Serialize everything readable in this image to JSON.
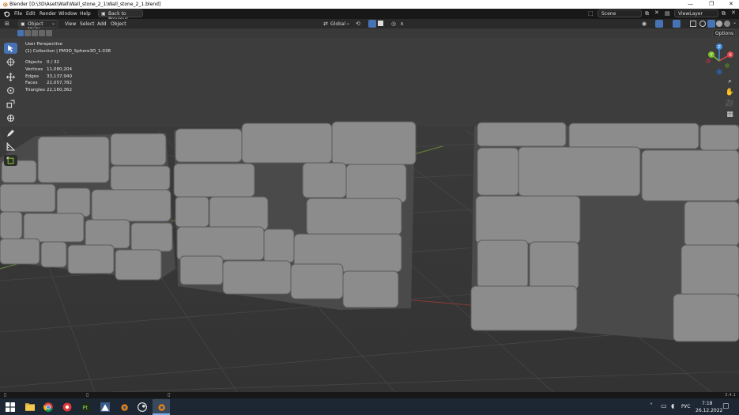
{
  "window": {
    "title": "Blender [D:\\3D\\Aset\\Wall\\Wall_stone_2_1\\Wall_stone_2_1.blend]",
    "minimize": "—",
    "maximize": "❐",
    "close": "✕"
  },
  "menubar": {
    "items": [
      "File",
      "Edit",
      "Render",
      "Window",
      "Help"
    ],
    "back_button": "Back to Previous",
    "scene_label": "Scene",
    "viewlayer_label": "ViewLayer"
  },
  "header": {
    "mode": "Object Mode",
    "menus": [
      "View",
      "Select",
      "Add",
      "Object"
    ],
    "transform_orientation": "Global"
  },
  "options_label": "Options",
  "viewport": {
    "perspective": "User Perspective",
    "collection": "(1) Collection | PM3D_Sphere3D_1.038",
    "stats": [
      {
        "label": "Objects",
        "value": "0 / 32"
      },
      {
        "label": "Vertices",
        "value": "11,080,204"
      },
      {
        "label": "Edges",
        "value": "33,137,940"
      },
      {
        "label": "Faces",
        "value": "22,057,782"
      },
      {
        "label": "Triangles",
        "value": "22,160,362"
      }
    ]
  },
  "gizmo": {
    "y": "Y",
    "x": "X",
    "z": "Z"
  },
  "statusbar": {
    "version": "3.4.1"
  },
  "taskbar": {
    "lang": "РУС",
    "time": "7:18",
    "date": "26.12.2022"
  },
  "colors": {
    "accent": "#4772b3",
    "viewport_bg": "#3c3c3c",
    "taskbar_bg": "#1d2733",
    "x_axis": "#e0454d",
    "y_axis": "#7fbf2a",
    "z_axis": "#3f8ee0"
  }
}
